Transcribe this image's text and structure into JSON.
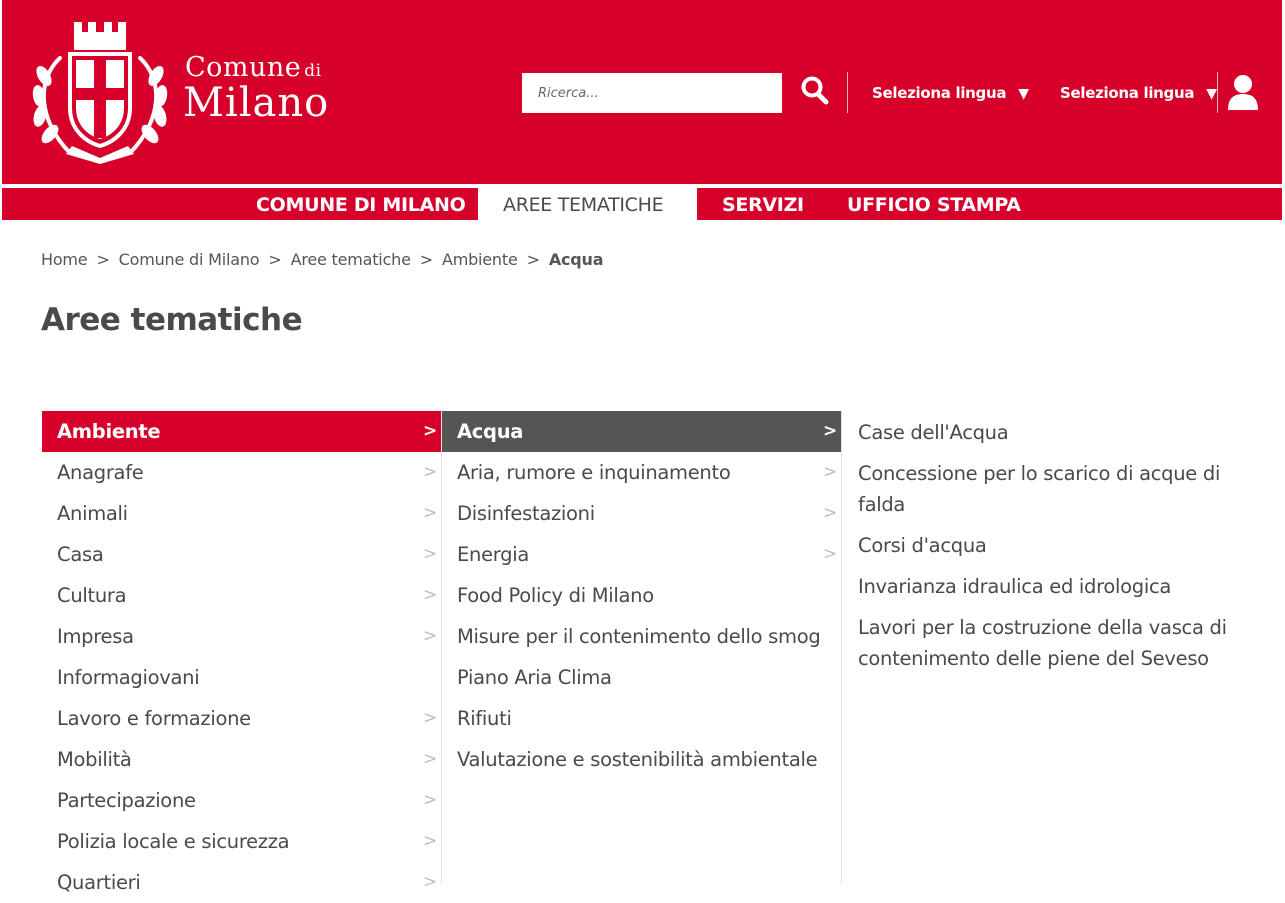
{
  "header": {
    "logo_line1": "Comune",
    "logo_di": "di",
    "logo_line2": "Milano",
    "search_placeholder": "Ricerca...",
    "lang_select_1": "Seleziona lingua",
    "lang_select_2": "Seleziona lingua",
    "search_icon": "search-icon",
    "user_icon": "user-icon",
    "brand_color": "#d6002a"
  },
  "nav": {
    "items": [
      {
        "label": "COMUNE DI MILANO",
        "active": false
      },
      {
        "label": "AREE TEMATICHE",
        "active": true
      },
      {
        "label": "SERVIZI",
        "active": false
      },
      {
        "label": "UFFICIO STAMPA",
        "active": false
      }
    ]
  },
  "breadcrumb": {
    "items": [
      "Home",
      "Comune di Milano",
      "Aree tematiche",
      "Ambiente"
    ],
    "current": "Acqua",
    "separator": ">"
  },
  "page_title": "Aree tematiche",
  "column1": {
    "items": [
      {
        "label": "Ambiente",
        "arrow": ">"
      },
      {
        "label": "Anagrafe",
        "arrow": ">"
      },
      {
        "label": "Animali",
        "arrow": ">"
      },
      {
        "label": "Casa",
        "arrow": ">"
      },
      {
        "label": "Cultura",
        "arrow": ">"
      },
      {
        "label": "Impresa",
        "arrow": ">"
      },
      {
        "label": "Informagiovani",
        "arrow": ""
      },
      {
        "label": "Lavoro e formazione",
        "arrow": ">"
      },
      {
        "label": "Mobilità",
        "arrow": ">"
      },
      {
        "label": "Partecipazione",
        "arrow": ">"
      },
      {
        "label": "Polizia locale e sicurezza",
        "arrow": ">"
      },
      {
        "label": "Quartieri",
        "arrow": ">"
      }
    ]
  },
  "column2": {
    "items": [
      {
        "label": "Acqua",
        "arrow": ">"
      },
      {
        "label": "Aria, rumore e inquinamento",
        "arrow": ">"
      },
      {
        "label": "Disinfestazioni",
        "arrow": ">"
      },
      {
        "label": "Energia",
        "arrow": ">"
      },
      {
        "label": "Food Policy di Milano",
        "arrow": ""
      },
      {
        "label": "Misure per il contenimento dello smog",
        "arrow": ""
      },
      {
        "label": "Piano Aria Clima",
        "arrow": ""
      },
      {
        "label": "Rifiuti",
        "arrow": ""
      },
      {
        "label": "Valutazione e sostenibilità ambientale",
        "arrow": ""
      }
    ]
  },
  "column3": {
    "items": [
      "Case dell'Acqua",
      "Concessione per lo scarico di acque di falda",
      "Corsi d'acqua",
      "Invarianza idraulica ed idrologica",
      "Lavori per la costruzione della vasca di contenimento delle piene del Seveso"
    ]
  }
}
